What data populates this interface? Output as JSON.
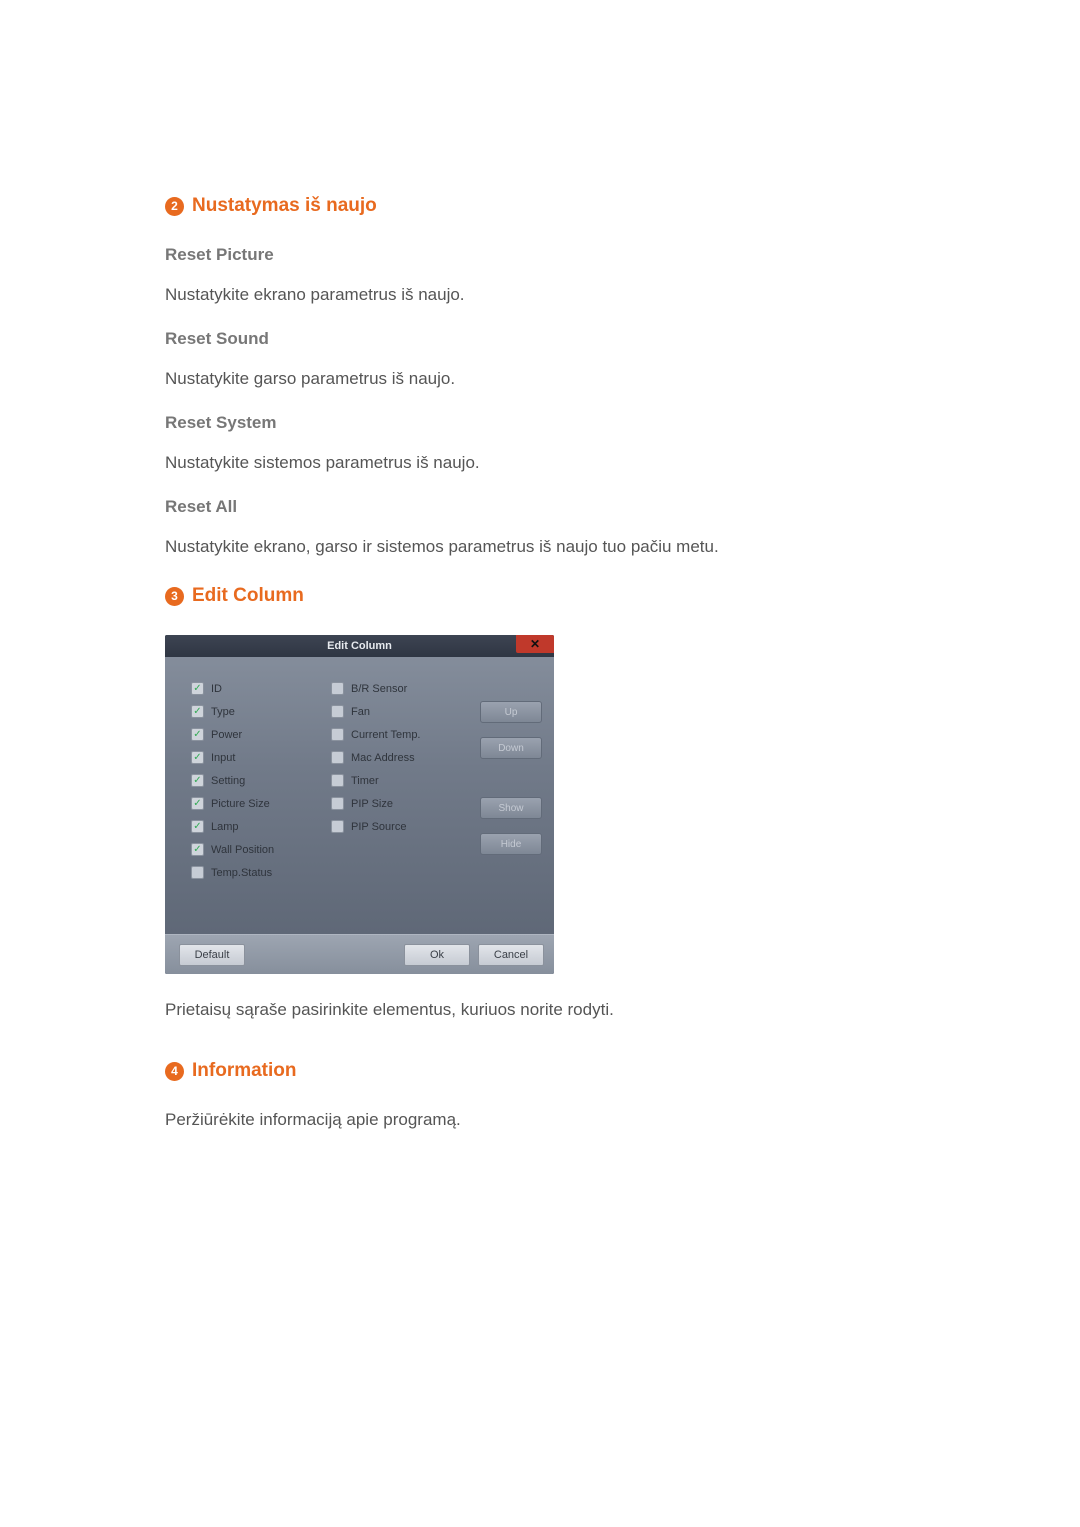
{
  "sections": {
    "s2": {
      "badge": "2",
      "title": "Nustatymas iš naujo",
      "items": [
        {
          "head": "Reset Picture",
          "body": "Nustatykite ekrano parametrus iš naujo."
        },
        {
          "head": "Reset Sound",
          "body": "Nustatykite garso parametrus iš naujo."
        },
        {
          "head": "Reset System",
          "body": "Nustatykite sistemos parametrus iš naujo."
        },
        {
          "head": "Reset All",
          "body": "Nustatykite ekrano, garso ir sistemos parametrus iš naujo tuo pačiu metu."
        }
      ]
    },
    "s3": {
      "badge": "3",
      "title": "Edit Column",
      "caption": "Prietaisų sąraše pasirinkite elementus, kuriuos norite rodyti."
    },
    "s4": {
      "badge": "4",
      "title": "Information",
      "body": "Peržiūrėkite informaciją apie programą."
    }
  },
  "dialog": {
    "title": "Edit Column",
    "close_glyph": "✕",
    "left_col": [
      {
        "label": "ID",
        "checked": true
      },
      {
        "label": "Type",
        "checked": true
      },
      {
        "label": "Power",
        "checked": true
      },
      {
        "label": "Input",
        "checked": true
      },
      {
        "label": "Setting",
        "checked": true
      },
      {
        "label": "Picture Size",
        "checked": true
      },
      {
        "label": "Lamp",
        "checked": true
      },
      {
        "label": "Wall Position",
        "checked": true
      },
      {
        "label": "Temp.Status",
        "checked": false
      }
    ],
    "right_col": [
      {
        "label": "B/R Sensor",
        "checked": false
      },
      {
        "label": "Fan",
        "checked": false
      },
      {
        "label": "Current Temp.",
        "checked": false
      },
      {
        "label": "Mac Address",
        "checked": false
      },
      {
        "label": "Timer",
        "checked": false
      },
      {
        "label": "PIP Size",
        "checked": false
      },
      {
        "label": "PIP Source",
        "checked": false
      }
    ],
    "side_buttons": {
      "up": "Up",
      "down": "Down",
      "show": "Show",
      "hide": "Hide"
    },
    "footer": {
      "default_": "Default",
      "ok": "Ok",
      "cancel": "Cancel"
    }
  }
}
